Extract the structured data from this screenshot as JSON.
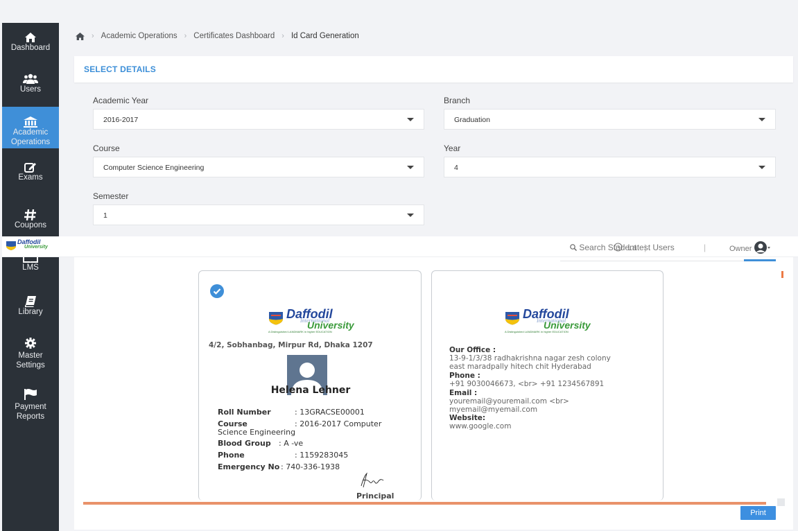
{
  "sidebar": {
    "items": [
      {
        "label": "Dashboard",
        "icon": "home-icon"
      },
      {
        "label": "Users",
        "icon": "users-icon"
      },
      {
        "label": "Academic",
        "label2": "Operations",
        "icon": "bank-icon",
        "active": true
      },
      {
        "label": "Exams",
        "icon": "edit-icon"
      },
      {
        "label": "Coupons",
        "icon": "hash-icon"
      },
      {
        "label": "LMS",
        "icon": "book-icon"
      },
      {
        "label": "Library",
        "icon": "book-icon"
      },
      {
        "label": "Master",
        "label2": "Settings",
        "icon": "gear-icon"
      },
      {
        "label": "Payment",
        "label2": "Reports",
        "icon": "flag-icon"
      }
    ]
  },
  "breadcrumb": {
    "items": [
      "Academic Operations",
      "Certificates Dashboard",
      "Id Card Generation"
    ]
  },
  "panel": {
    "title": "SELECT DETAILS"
  },
  "form": {
    "academic_year": {
      "label": "Academic Year",
      "value": "2016-2017"
    },
    "branch": {
      "label": "Branch",
      "value": "Graduation"
    },
    "course": {
      "label": "Course",
      "value": "Computer Science Engineering"
    },
    "year": {
      "label": "Year",
      "value": "4"
    },
    "semester": {
      "label": "Semester",
      "value": "1"
    }
  },
  "header_overlay": {
    "logo_text": "Daffodil",
    "logo_sub": "University",
    "search": "Search Student",
    "latest": "Latest Users",
    "owner": "Owner"
  },
  "front_card": {
    "logo_main": "Daffodil",
    "logo_intl": "International",
    "logo_univ": "University",
    "logo_tag": "A Distinguished LANDMARK in higher EDUCATION",
    "address": "4/2, Sobhanbag, Mirpur Rd, Dhaka 1207",
    "name": "Helena Lehner",
    "roll_label": "Roll Number",
    "roll_value": ": 13GRACSE00001",
    "course_label": "Course",
    "course_value": ": 2016-2017 Computer",
    "course_value2": "Science Engineering",
    "blood_label": "Blood Group",
    "blood_value": ": A -ve",
    "phone_label": "Phone",
    "phone_value": ": 1159283045",
    "emergency_label": "Emergency No",
    "emergency_value": ": 740-336-1938",
    "principal": "Principal"
  },
  "back_card": {
    "logo_main": "Daffodil",
    "logo_intl": "International",
    "logo_univ": "University",
    "logo_tag": "A Distinguished LANDMARK in higher EDUCATION",
    "office_label": "Our Office :",
    "office_line1": "13-9-1/3/38 radhakrishna nagar zesh colony",
    "office_line2": "east maradpally hitech chit Hyderabad",
    "phone_label": "Phone :",
    "phone_value": "+91 9030046673, <br> +91 1234567891",
    "email_label": "Email :",
    "email_line1": "youremail@youremail.com <br>",
    "email_line2": "myemail@myemail.com",
    "website_label": "Website:",
    "website_value": "www.google.com"
  },
  "actions": {
    "print": "Print"
  },
  "colors": {
    "sidebar_bg": "#2b3138",
    "accent": "#3f8fd8",
    "orange": "#e9926a"
  }
}
